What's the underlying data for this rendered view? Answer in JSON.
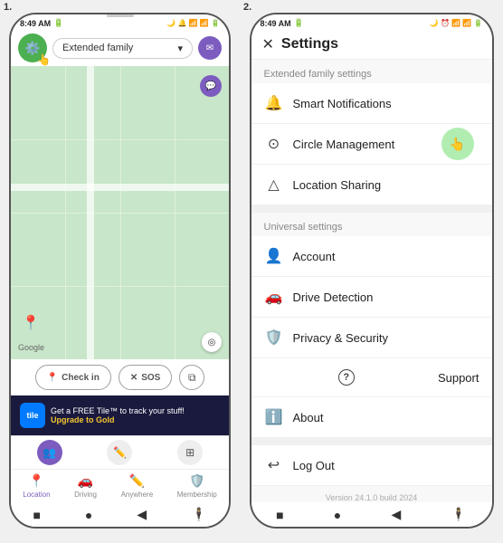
{
  "left": {
    "panel_number": "1.",
    "status_bar": {
      "time": "8:49 AM",
      "icons": "📶"
    },
    "dropdown": {
      "label": "Extended family",
      "arrow": "▾"
    },
    "map": {
      "google_label": "Google",
      "compass": "◎"
    },
    "checkin_btn": "Check in",
    "sos_btn": "SOS",
    "promo": {
      "logo": "tile",
      "line1": "Get a FREE Tile™ to track your stuff!",
      "line2": "Upgrade to Gold"
    },
    "nav": {
      "items": [
        {
          "label": "Location",
          "icon": "📍"
        },
        {
          "label": "Driving",
          "icon": "🚗"
        },
        {
          "label": "Anywhere",
          "icon": "✏️"
        },
        {
          "label": "Membership",
          "icon": "🛡️"
        }
      ]
    },
    "android_nav": {
      "back": "■",
      "home": "●",
      "recent": "◀",
      "menu": "🕴️"
    }
  },
  "right": {
    "panel_number": "2.",
    "status_bar": {
      "time": "8:49 AM"
    },
    "header": {
      "close": "✕",
      "title": "Settings"
    },
    "extended_section": {
      "header": "Extended family settings",
      "items": [
        {
          "icon": "🔔",
          "label": "Smart Notifications"
        },
        {
          "icon": "⊙",
          "label": "Circle Management"
        },
        {
          "icon": "△",
          "label": "Location Sharing"
        }
      ]
    },
    "universal_section": {
      "header": "Universal settings",
      "items": [
        {
          "icon": "👤",
          "label": "Account"
        },
        {
          "icon": "🚗",
          "label": "Drive Detection"
        },
        {
          "icon": "🛡️",
          "label": "Privacy & Security"
        },
        {
          "icon": "?",
          "label": "Support"
        },
        {
          "icon": "ℹ️",
          "label": "About"
        }
      ]
    },
    "logout": {
      "icon": "↩",
      "label": "Log Out"
    },
    "version": "Version 24.1.0 build 2024"
  }
}
